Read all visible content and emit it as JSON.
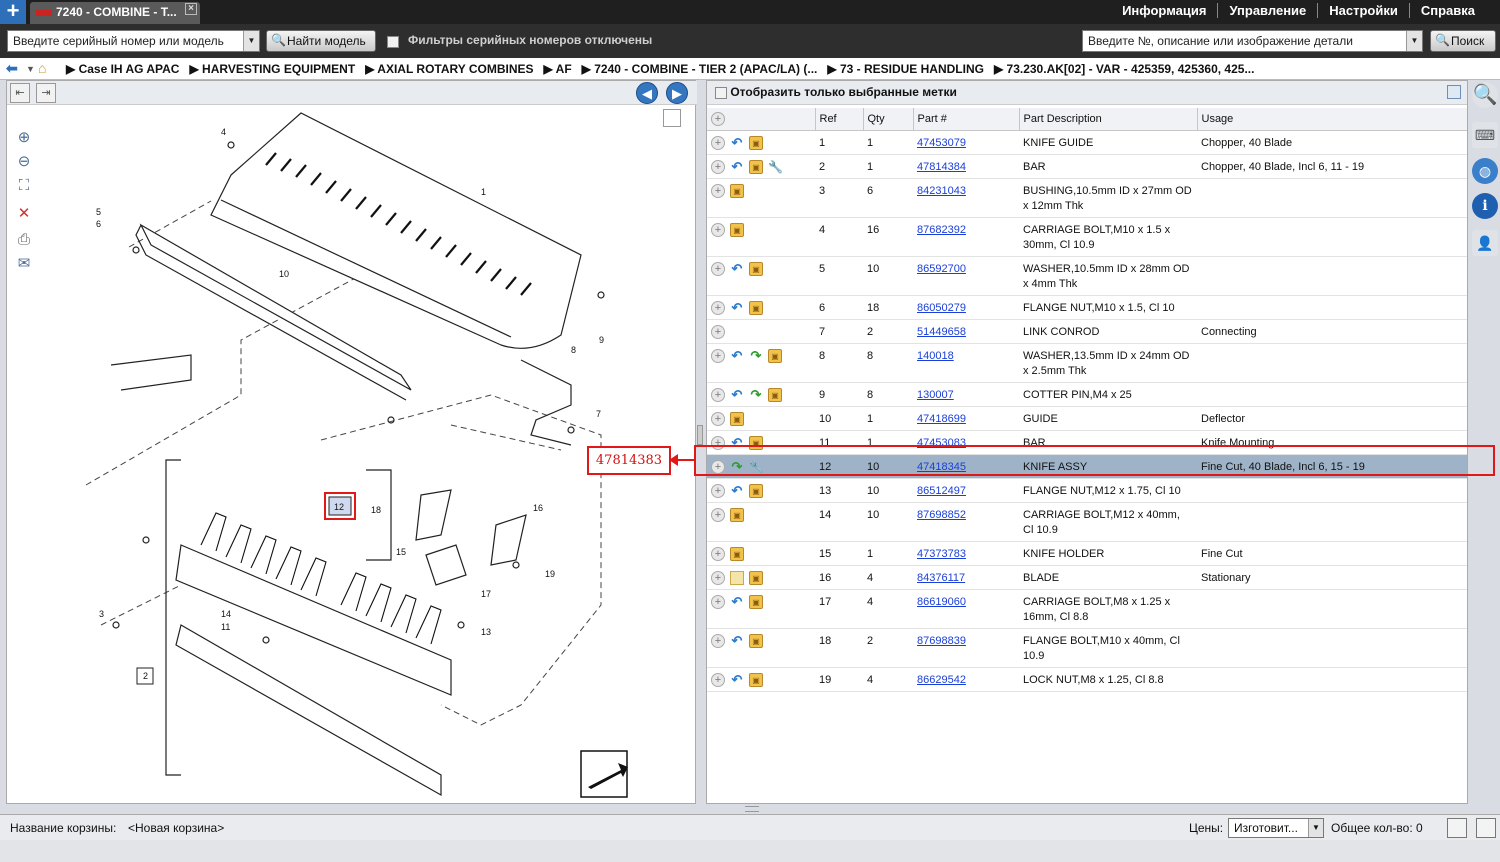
{
  "app": {
    "tab_title": "7240 - COMBINE - T...",
    "menu": [
      "Информация",
      "Управление",
      "Настройки",
      "Справка"
    ]
  },
  "search": {
    "serial_placeholder": "Введите серийный номер или модель",
    "find_model_label": "Найти модель",
    "filter_label": "Фильтры серийных номеров отключены",
    "part_placeholder": "Введите №, описание или изображение детали",
    "search_label": "Поиск"
  },
  "breadcrumb": [
    "▶ Case IH AG APAC",
    "▶ HARVESTING EQUIPMENT",
    "▶ AXIAL ROTARY COMBINES",
    "▶ AF",
    "▶ 7240 - COMBINE - TIER 2 (APAC/LA) (...",
    "▶ 73 - RESIDUE HANDLING",
    "▶ 73.230.AK[02] - VAR - 425359, 425360, 425..."
  ],
  "parts_list": {
    "filter_label": "Отобразить только выбранные метки",
    "columns": [
      "Ref",
      "Qty",
      "Part #",
      "Part Description",
      "Usage"
    ],
    "rows": [
      {
        "icons": [
          "plus",
          "back",
          "box"
        ],
        "ref": "1",
        "qty": "1",
        "part": "47453079",
        "desc": "KNIFE GUIDE",
        "usage": "Chopper, 40 Blade"
      },
      {
        "icons": [
          "plus",
          "back",
          "box",
          "wrench"
        ],
        "ref": "2",
        "qty": "1",
        "part": "47814384",
        "desc": "BAR",
        "usage": "Chopper, 40 Blade, Incl 6, 11 - 19"
      },
      {
        "icons": [
          "plus",
          "box"
        ],
        "ref": "3",
        "qty": "6",
        "part": "84231043",
        "desc": "BUSHING,10.5mm ID x 27mm OD x 12mm Thk",
        "usage": ""
      },
      {
        "icons": [
          "plus",
          "box"
        ],
        "ref": "4",
        "qty": "16",
        "part": "87682392",
        "desc": "CARRIAGE BOLT,M10 x 1.5 x 30mm, Cl 10.9",
        "usage": ""
      },
      {
        "icons": [
          "plus",
          "back",
          "box"
        ],
        "ref": "5",
        "qty": "10",
        "part": "86592700",
        "desc": "WASHER,10.5mm ID x 28mm OD x 4mm Thk",
        "usage": ""
      },
      {
        "icons": [
          "plus",
          "back",
          "box"
        ],
        "ref": "6",
        "qty": "18",
        "part": "86050279",
        "desc": "FLANGE NUT,M10 x 1.5, Cl 10",
        "usage": ""
      },
      {
        "icons": [
          "plus"
        ],
        "ref": "7",
        "qty": "2",
        "part": "51449658",
        "desc": "LINK CONROD",
        "usage": "Connecting"
      },
      {
        "icons": [
          "plus",
          "back",
          "fwd",
          "box"
        ],
        "ref": "8",
        "qty": "8",
        "part": "140018",
        "desc": "WASHER,13.5mm ID x 24mm OD x 2.5mm Thk",
        "usage": ""
      },
      {
        "icons": [
          "plus",
          "back",
          "fwd",
          "box"
        ],
        "ref": "9",
        "qty": "8",
        "part": "130007",
        "desc": "COTTER PIN,M4 x 25",
        "usage": ""
      },
      {
        "icons": [
          "plus",
          "box"
        ],
        "ref": "10",
        "qty": "1",
        "part": "47418699",
        "desc": "GUIDE",
        "usage": "Deflector"
      },
      {
        "icons": [
          "plus",
          "back",
          "box"
        ],
        "ref": "11",
        "qty": "1",
        "part": "47453083",
        "desc": "BAR",
        "usage": "Knife Mounting"
      },
      {
        "icons": [
          "plus",
          "fwd",
          "wrench"
        ],
        "ref": "12",
        "qty": "10",
        "part": "47418345",
        "desc": "KNIFE ASSY",
        "usage": "Fine Cut, 40 Blade, Incl 6, 15 - 19"
      },
      {
        "icons": [
          "plus",
          "back",
          "box"
        ],
        "ref": "13",
        "qty": "10",
        "part": "86512497",
        "desc": "FLANGE NUT,M12 x 1.75, Cl 10",
        "usage": ""
      },
      {
        "icons": [
          "plus",
          "box"
        ],
        "ref": "14",
        "qty": "10",
        "part": "87698852",
        "desc": "CARRIAGE BOLT,M12 x 40mm, Cl 10.9",
        "usage": ""
      },
      {
        "icons": [
          "plus",
          "box"
        ],
        "ref": "15",
        "qty": "1",
        "part": "47373783",
        "desc": "KNIFE HOLDER",
        "usage": "Fine Cut"
      },
      {
        "icons": [
          "plus",
          "note",
          "box"
        ],
        "ref": "16",
        "qty": "4",
        "part": "84376117",
        "desc": "BLADE",
        "usage": "Stationary"
      },
      {
        "icons": [
          "plus",
          "back",
          "box"
        ],
        "ref": "17",
        "qty": "4",
        "part": "86619060",
        "desc": "CARRIAGE BOLT,M8 x 1.25 x 16mm, Cl 8.8",
        "usage": ""
      },
      {
        "icons": [
          "plus",
          "back",
          "box"
        ],
        "ref": "18",
        "qty": "2",
        "part": "87698839",
        "desc": "FLANGE BOLT,M10 x 40mm, Cl 10.9",
        "usage": ""
      },
      {
        "icons": [
          "plus",
          "back",
          "box"
        ],
        "ref": "19",
        "qty": "4",
        "part": "86629542",
        "desc": "LOCK NUT,M8 x 1.25, Cl 8.8",
        "usage": ""
      }
    ]
  },
  "annotation": {
    "callout": "47814383"
  },
  "diagram": {
    "labels": [
      "1",
      "2",
      "3",
      "4",
      "5",
      "6",
      "7",
      "8",
      "9",
      "10",
      "11",
      "12",
      "13",
      "14",
      "15",
      "16",
      "17",
      "18",
      "19"
    ]
  },
  "bottom": {
    "basket_label": "Название корзины:",
    "basket_value": "<Новая корзина>",
    "prices_label": "Цены:",
    "maker_value": "Изготовит...",
    "total": "Общее кол-во: 0"
  },
  "colors": {
    "selected_row": "#9fb3c8",
    "callout": "#e01818",
    "link": "#1a3fd8"
  }
}
